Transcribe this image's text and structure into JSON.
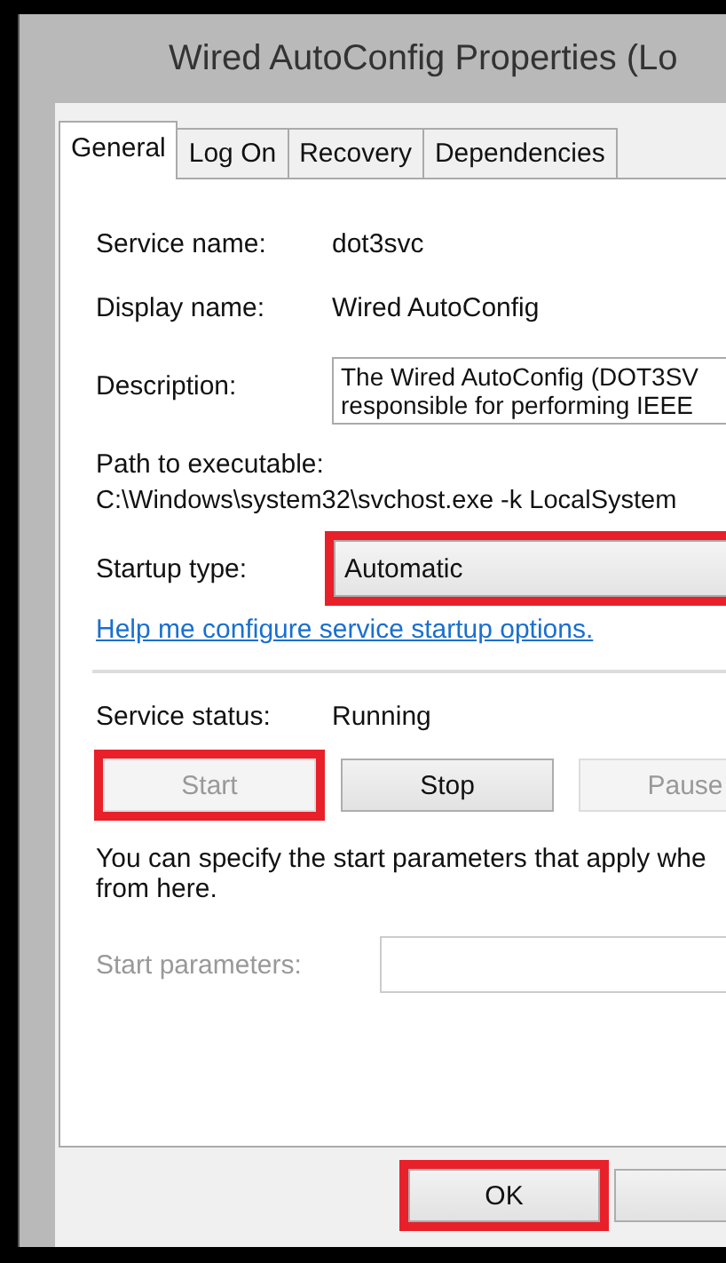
{
  "window": {
    "title": "Wired AutoConfig Properties (Lo"
  },
  "tabs": [
    {
      "label": "General",
      "selected": true
    },
    {
      "label": "Log On",
      "selected": false
    },
    {
      "label": "Recovery",
      "selected": false
    },
    {
      "label": "Dependencies",
      "selected": false
    }
  ],
  "fields": [
    {
      "kind": "text",
      "label": "Service name:",
      "value": "dot3svc"
    },
    {
      "kind": "text",
      "label": "Display name:",
      "value": "Wired AutoConfig"
    },
    {
      "kind": "textarea",
      "label": "Description:",
      "lines": [
        "The Wired AutoConfig (DOT3SV",
        "responsible for performing IEEE"
      ]
    }
  ],
  "path": {
    "label": "Path to executable:",
    "value": "C:\\Windows\\system32\\svchost.exe -k LocalSystem"
  },
  "startup_type": {
    "label": "Startup type:",
    "value": "Automatic",
    "highlighted": true
  },
  "help_link": "Help me configure service startup options.",
  "service_status": {
    "label": "Service status:",
    "value": "Running"
  },
  "service_buttons": [
    {
      "label": "Start",
      "disabled": true,
      "highlighted": true
    },
    {
      "label": "Stop",
      "disabled": false,
      "highlighted": false
    },
    {
      "label": "Pause",
      "disabled": true,
      "highlighted": false
    }
  ],
  "note_lines": [
    "You can specify the start parameters that apply whe",
    "from here."
  ],
  "start_parameters": {
    "label": "Start parameters:",
    "disabled": true
  },
  "dialog_buttons": [
    {
      "label": "OK",
      "highlighted": true
    },
    {
      "highlighted": false
    }
  ]
}
